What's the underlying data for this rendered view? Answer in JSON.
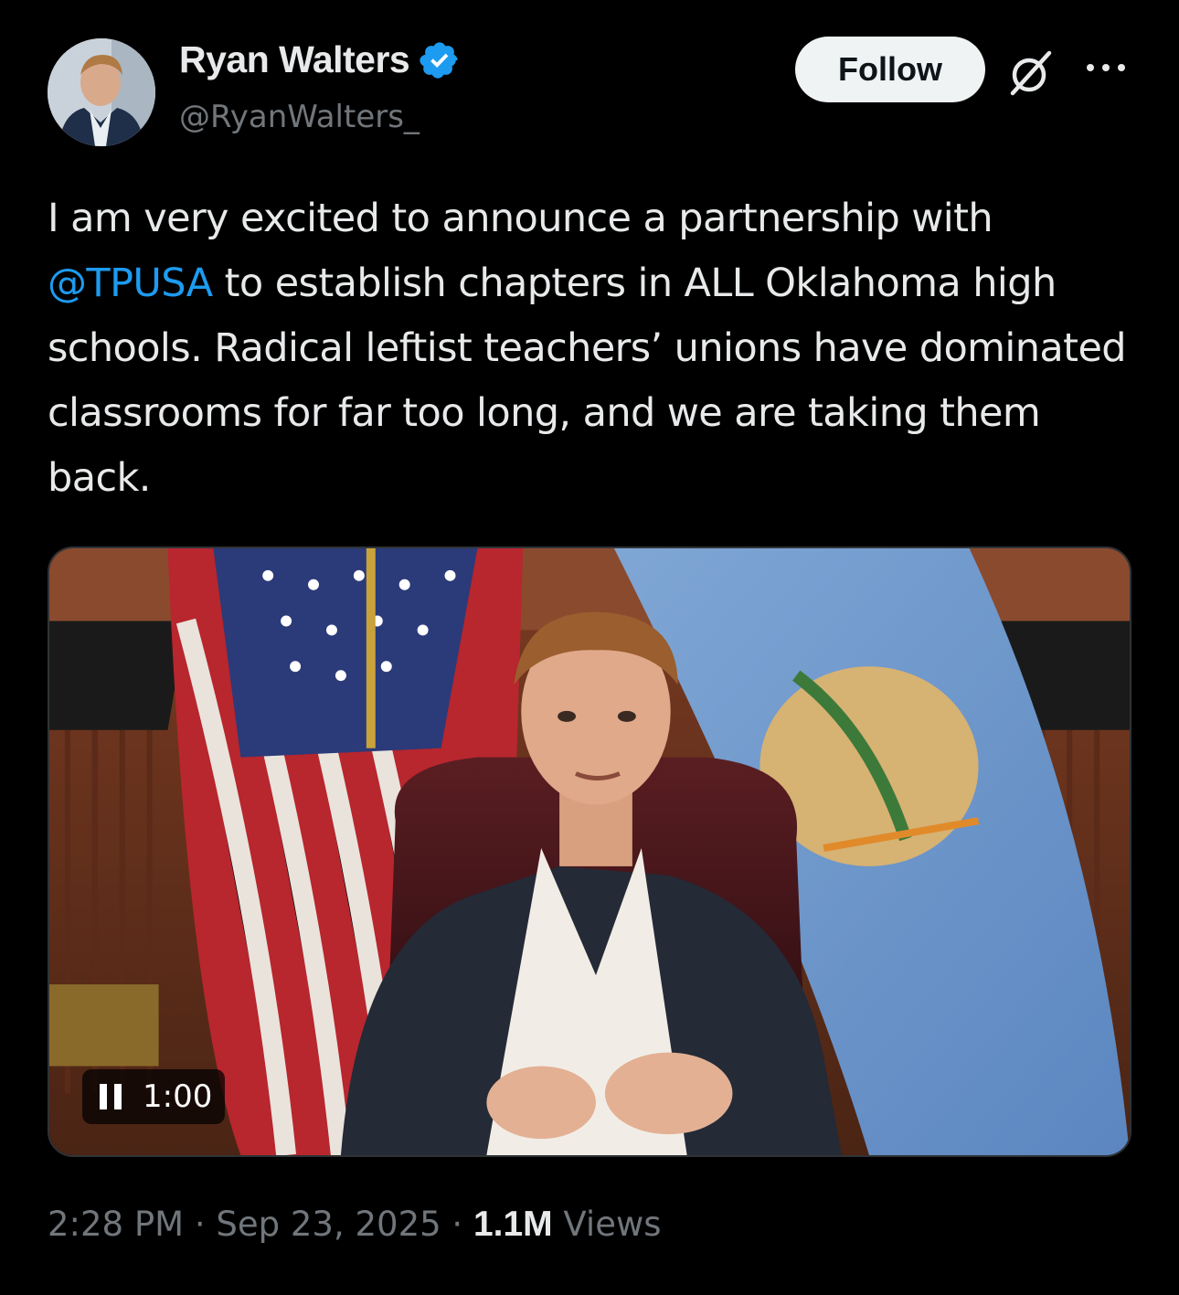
{
  "author": {
    "display_name": "Ryan Walters",
    "handle": "@RyanWalters_",
    "verified": true,
    "verified_color": "#1d9bf0"
  },
  "actions": {
    "follow_label": "Follow",
    "grok_icon": "grok-icon",
    "more_icon": "more-icon"
  },
  "tweet": {
    "text_lead": "I am very excited to announce a partnership with",
    "mention": "@TPUSA",
    "text_rest": "to establish chapters in ALL Oklahoma high schools. Radical leftist teachers’ unions have dominated classrooms for far too long, and we are taking them back."
  },
  "media": {
    "type": "video",
    "state": "playing",
    "time_label": "1:00",
    "control_icon": "pause-icon"
  },
  "meta": {
    "time": "2:28 PM",
    "separator": "·",
    "date": "Sep 23, 2025",
    "views_count": "1.1M",
    "views_label": "Views"
  },
  "colors": {
    "background": "#000000",
    "text": "#e7e9ea",
    "secondary": "#71767b",
    "link": "#1d9bf0",
    "follow_bg": "#eff3f4"
  }
}
